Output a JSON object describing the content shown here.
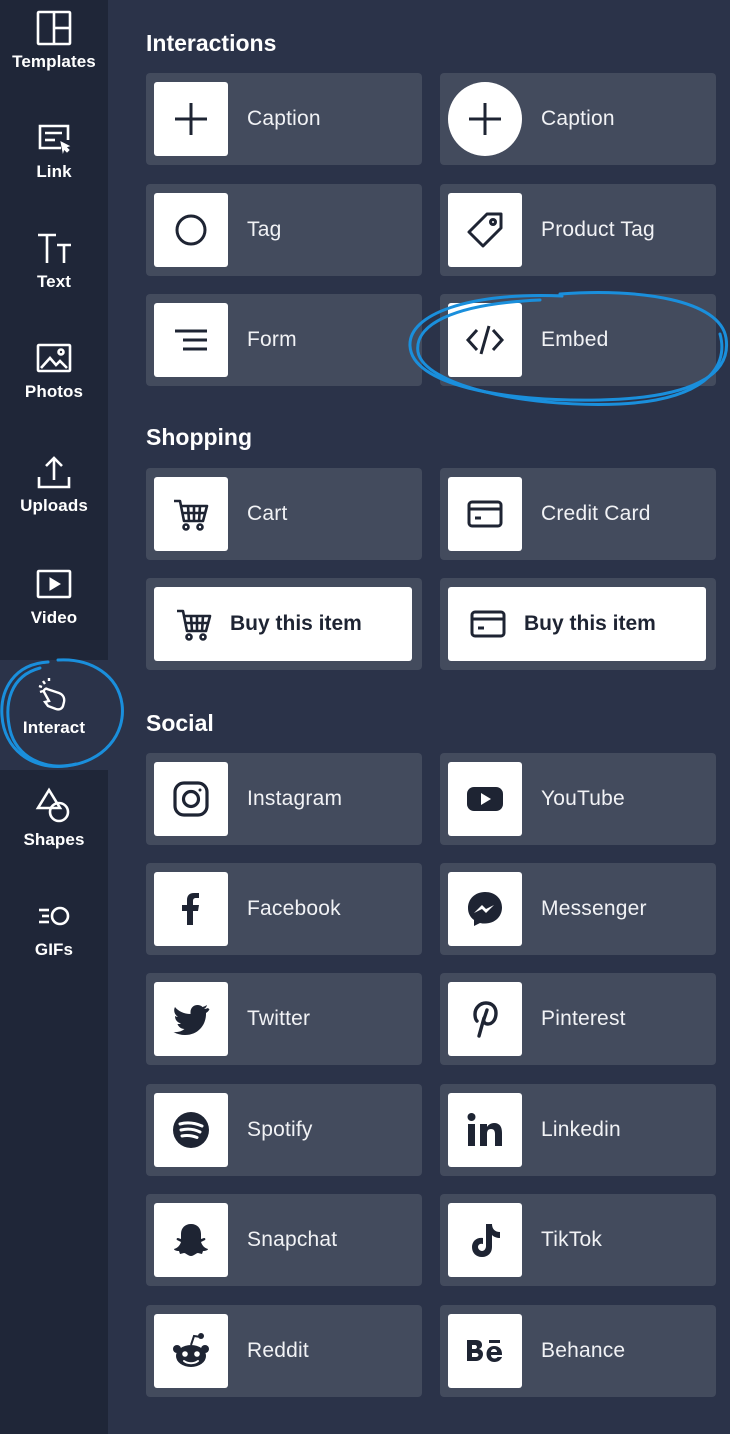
{
  "sidebar": {
    "items": [
      {
        "label": "Templates",
        "icon": "templates-icon"
      },
      {
        "label": "Link",
        "icon": "link-icon"
      },
      {
        "label": "Text",
        "icon": "text-icon"
      },
      {
        "label": "Photos",
        "icon": "photos-icon"
      },
      {
        "label": "Uploads",
        "icon": "uploads-icon"
      },
      {
        "label": "Video",
        "icon": "video-icon"
      },
      {
        "label": "Interact",
        "icon": "interact-icon",
        "active": true
      },
      {
        "label": "Shapes",
        "icon": "shapes-icon"
      },
      {
        "label": "GIFs",
        "icon": "gifs-icon"
      }
    ]
  },
  "sections": {
    "interactions": {
      "title": "Interactions",
      "items": [
        {
          "label": "Caption",
          "icon": "plus-icon"
        },
        {
          "label": "Caption",
          "icon": "plus-circle-icon"
        },
        {
          "label": "Tag",
          "icon": "circle-icon"
        },
        {
          "label": "Product Tag",
          "icon": "price-tag-icon"
        },
        {
          "label": "Form",
          "icon": "form-lines-icon"
        },
        {
          "label": "Embed",
          "icon": "code-icon"
        }
      ]
    },
    "shopping": {
      "title": "Shopping",
      "items": [
        {
          "label": "Cart",
          "icon": "cart-icon"
        },
        {
          "label": "Credit Card",
          "icon": "credit-card-icon"
        },
        {
          "label": "Buy this item",
          "icon": "cart-icon"
        },
        {
          "label": "Buy this item",
          "icon": "credit-card-icon"
        }
      ]
    },
    "social": {
      "title": "Social",
      "items": [
        {
          "label": "Instagram",
          "icon": "instagram-icon"
        },
        {
          "label": "YouTube",
          "icon": "youtube-icon"
        },
        {
          "label": "Facebook",
          "icon": "facebook-icon"
        },
        {
          "label": "Messenger",
          "icon": "messenger-icon"
        },
        {
          "label": "Twitter",
          "icon": "twitter-icon"
        },
        {
          "label": "Pinterest",
          "icon": "pinterest-icon"
        },
        {
          "label": "Spotify",
          "icon": "spotify-icon"
        },
        {
          "label": "Linkedin",
          "icon": "linkedin-icon"
        },
        {
          "label": "Snapchat",
          "icon": "snapchat-icon"
        },
        {
          "label": "TikTok",
          "icon": "tiktok-icon"
        },
        {
          "label": "Reddit",
          "icon": "reddit-icon"
        },
        {
          "label": "Behance",
          "icon": "behance-icon"
        }
      ]
    }
  },
  "colors": {
    "sidebar_bg": "#1f2638",
    "panel_bg": "#2b3349",
    "tile_bg": "#434b5d",
    "annotation": "#1a8fdc"
  }
}
